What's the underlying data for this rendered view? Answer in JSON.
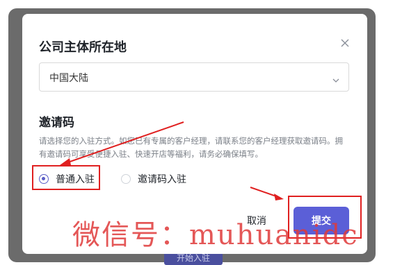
{
  "background_button": {
    "label": "开始入驻"
  },
  "modal": {
    "title": "公司主体所在地",
    "close_icon": "close-icon",
    "region_select": {
      "value": "中国大陆",
      "icon": "chevron-down-icon"
    },
    "invite_section": {
      "title": "邀请码",
      "description": "请选择您的入驻方式。如您已有专属的客户经理，请联系您的客户经理获取邀请码。拥有邀请码可享受便捷入驻、快速开店等福利，请务必确保填写。",
      "options": [
        {
          "label": "普通入驻",
          "checked": true
        },
        {
          "label": "邀请码入驻",
          "checked": false
        }
      ]
    },
    "buttons": {
      "cancel": "取消",
      "submit": "提交"
    }
  },
  "colors": {
    "accent": "#5b5fd7",
    "annotation": "#e02020",
    "watermark": "#e03a3a"
  },
  "watermark": "微信号：muhuanidc"
}
